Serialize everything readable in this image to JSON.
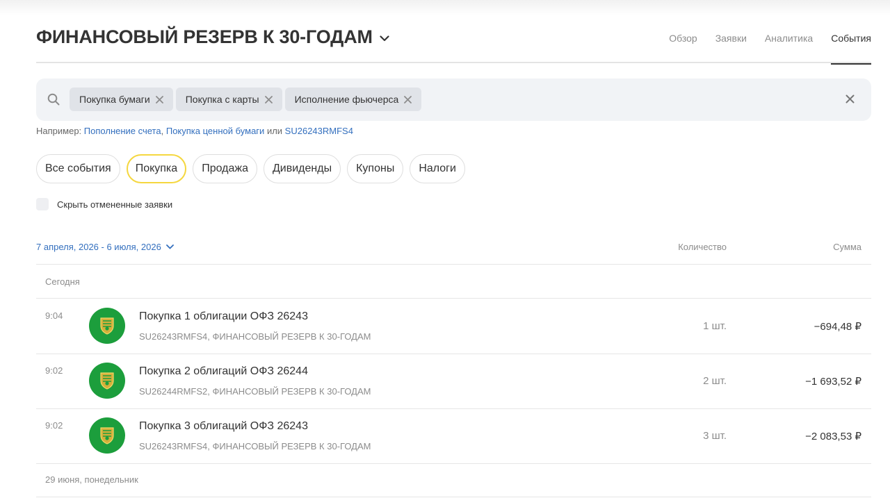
{
  "header": {
    "title": "ФИНАНСОВЫЙ РЕЗЕРВ К 30-ГОДАМ",
    "tabs": [
      {
        "label": "Обзор",
        "active": false
      },
      {
        "label": "Заявки",
        "active": false
      },
      {
        "label": "Аналитика",
        "active": false
      },
      {
        "label": "События",
        "active": true
      }
    ]
  },
  "search": {
    "chips": [
      "Покупка бумаги",
      "Покупка с карты",
      "Исполнение фьючерса"
    ]
  },
  "hint": {
    "prefix": "Например:",
    "example1": "Пополнение счета",
    "comma": ",",
    "example2": "Покупка ценной бумаги",
    "or": "или",
    "example3": "SU26243RMFS4"
  },
  "filters": [
    {
      "label": "Все события",
      "active": false
    },
    {
      "label": "Покупка",
      "active": true
    },
    {
      "label": "Продажа",
      "active": false
    },
    {
      "label": "Дивиденды",
      "active": false
    },
    {
      "label": "Купоны",
      "active": false
    },
    {
      "label": "Налоги",
      "active": false
    }
  ],
  "hide_cancelled": {
    "label": "Скрыть отмененные заявки",
    "checked": false
  },
  "list": {
    "date_range": "7 апреля, 2026 - 6 июля, 2026",
    "col_quantity": "Количество",
    "col_sum": "Сумма",
    "groups": [
      {
        "label": "Сегодня",
        "rows": [
          {
            "time": "9:04",
            "title": "Покупка 1 облигации ОФЗ 26243",
            "subtitle": "SU26243RMFS4, ФИНАНСОВЫЙ РЕЗЕРВ К 30-ГОДАМ",
            "quantity": "1 шт.",
            "sum": "−694,48 ₽"
          },
          {
            "time": "9:02",
            "title": "Покупка 2 облигаций ОФЗ 26244",
            "subtitle": "SU26244RMFS2, ФИНАНСОВЫЙ РЕЗЕРВ К 30-ГОДАМ",
            "quantity": "2 шт.",
            "sum": "−1 693,52 ₽"
          },
          {
            "time": "9:02",
            "title": "Покупка 3 облигаций ОФЗ 26243",
            "subtitle": "SU26243RMFS4, ФИНАНСОВЫЙ РЕЗЕРВ К 30-ГОДАМ",
            "quantity": "3 шт.",
            "sum": "−2 083,53 ₽"
          }
        ]
      },
      {
        "label": "29 июня, понедельник",
        "rows": []
      }
    ]
  },
  "icons": {
    "title_chevron": "chevron-down-icon",
    "search": "search-icon",
    "chip_remove": "close-icon",
    "clear": "close-icon",
    "date_chevron": "chevron-down-icon",
    "bond_logo": "minfin-emblem-icon"
  },
  "colors": {
    "accent_link": "#336fbe",
    "active_filter_border": "#f5d73f",
    "logo_bg": "#1c9e3c"
  }
}
